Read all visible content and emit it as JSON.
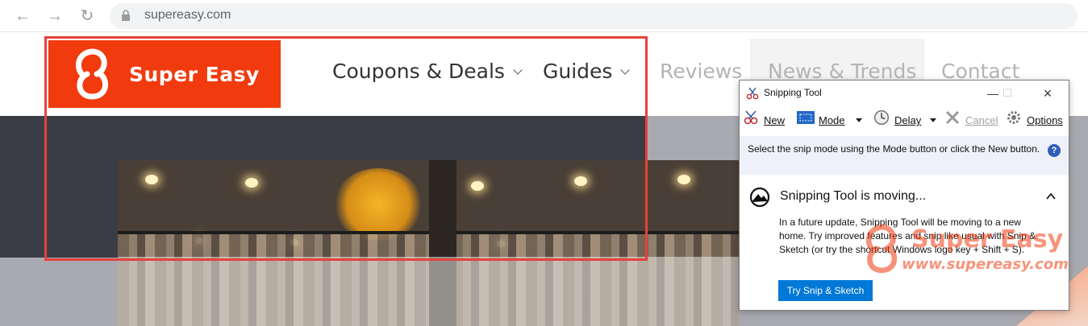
{
  "browser": {
    "url": "supereasy.com",
    "icons": [
      "back-arrow-icon",
      "forward-arrow-icon",
      "reload-icon",
      "lock-icon"
    ]
  },
  "site": {
    "brand": "Super Easy",
    "brand_color": "#f23a0f",
    "nav": [
      {
        "label": "Coupons & Deals",
        "has_menu": true
      },
      {
        "label": "Guides",
        "has_menu": true
      },
      {
        "label": "Reviews",
        "has_menu": false
      },
      {
        "label": "News & Trends",
        "has_menu": false
      },
      {
        "label": "Contact",
        "has_menu": false
      }
    ]
  },
  "highlight_color": "#e8403c",
  "snipping_tool": {
    "title": "Snipping Tool",
    "toolbar": {
      "new": "New",
      "mode": "Mode",
      "delay": "Delay",
      "cancel": "Cancel",
      "options": "Options"
    },
    "hint": "Select the snip mode using the Mode button or click the New button.",
    "notice_title": "Snipping Tool is moving...",
    "notice_body": "In a future update, Snipping Tool will be moving to a new home. Try improved features and snip like usual with Snip & Sketch (or try the shortcut Windows logo key + Shift + S).",
    "button": "Try Snip & Sketch",
    "button_color": "#0078d7"
  },
  "watermark": {
    "title": "Super Easy",
    "url": "www.supereasy.com"
  }
}
